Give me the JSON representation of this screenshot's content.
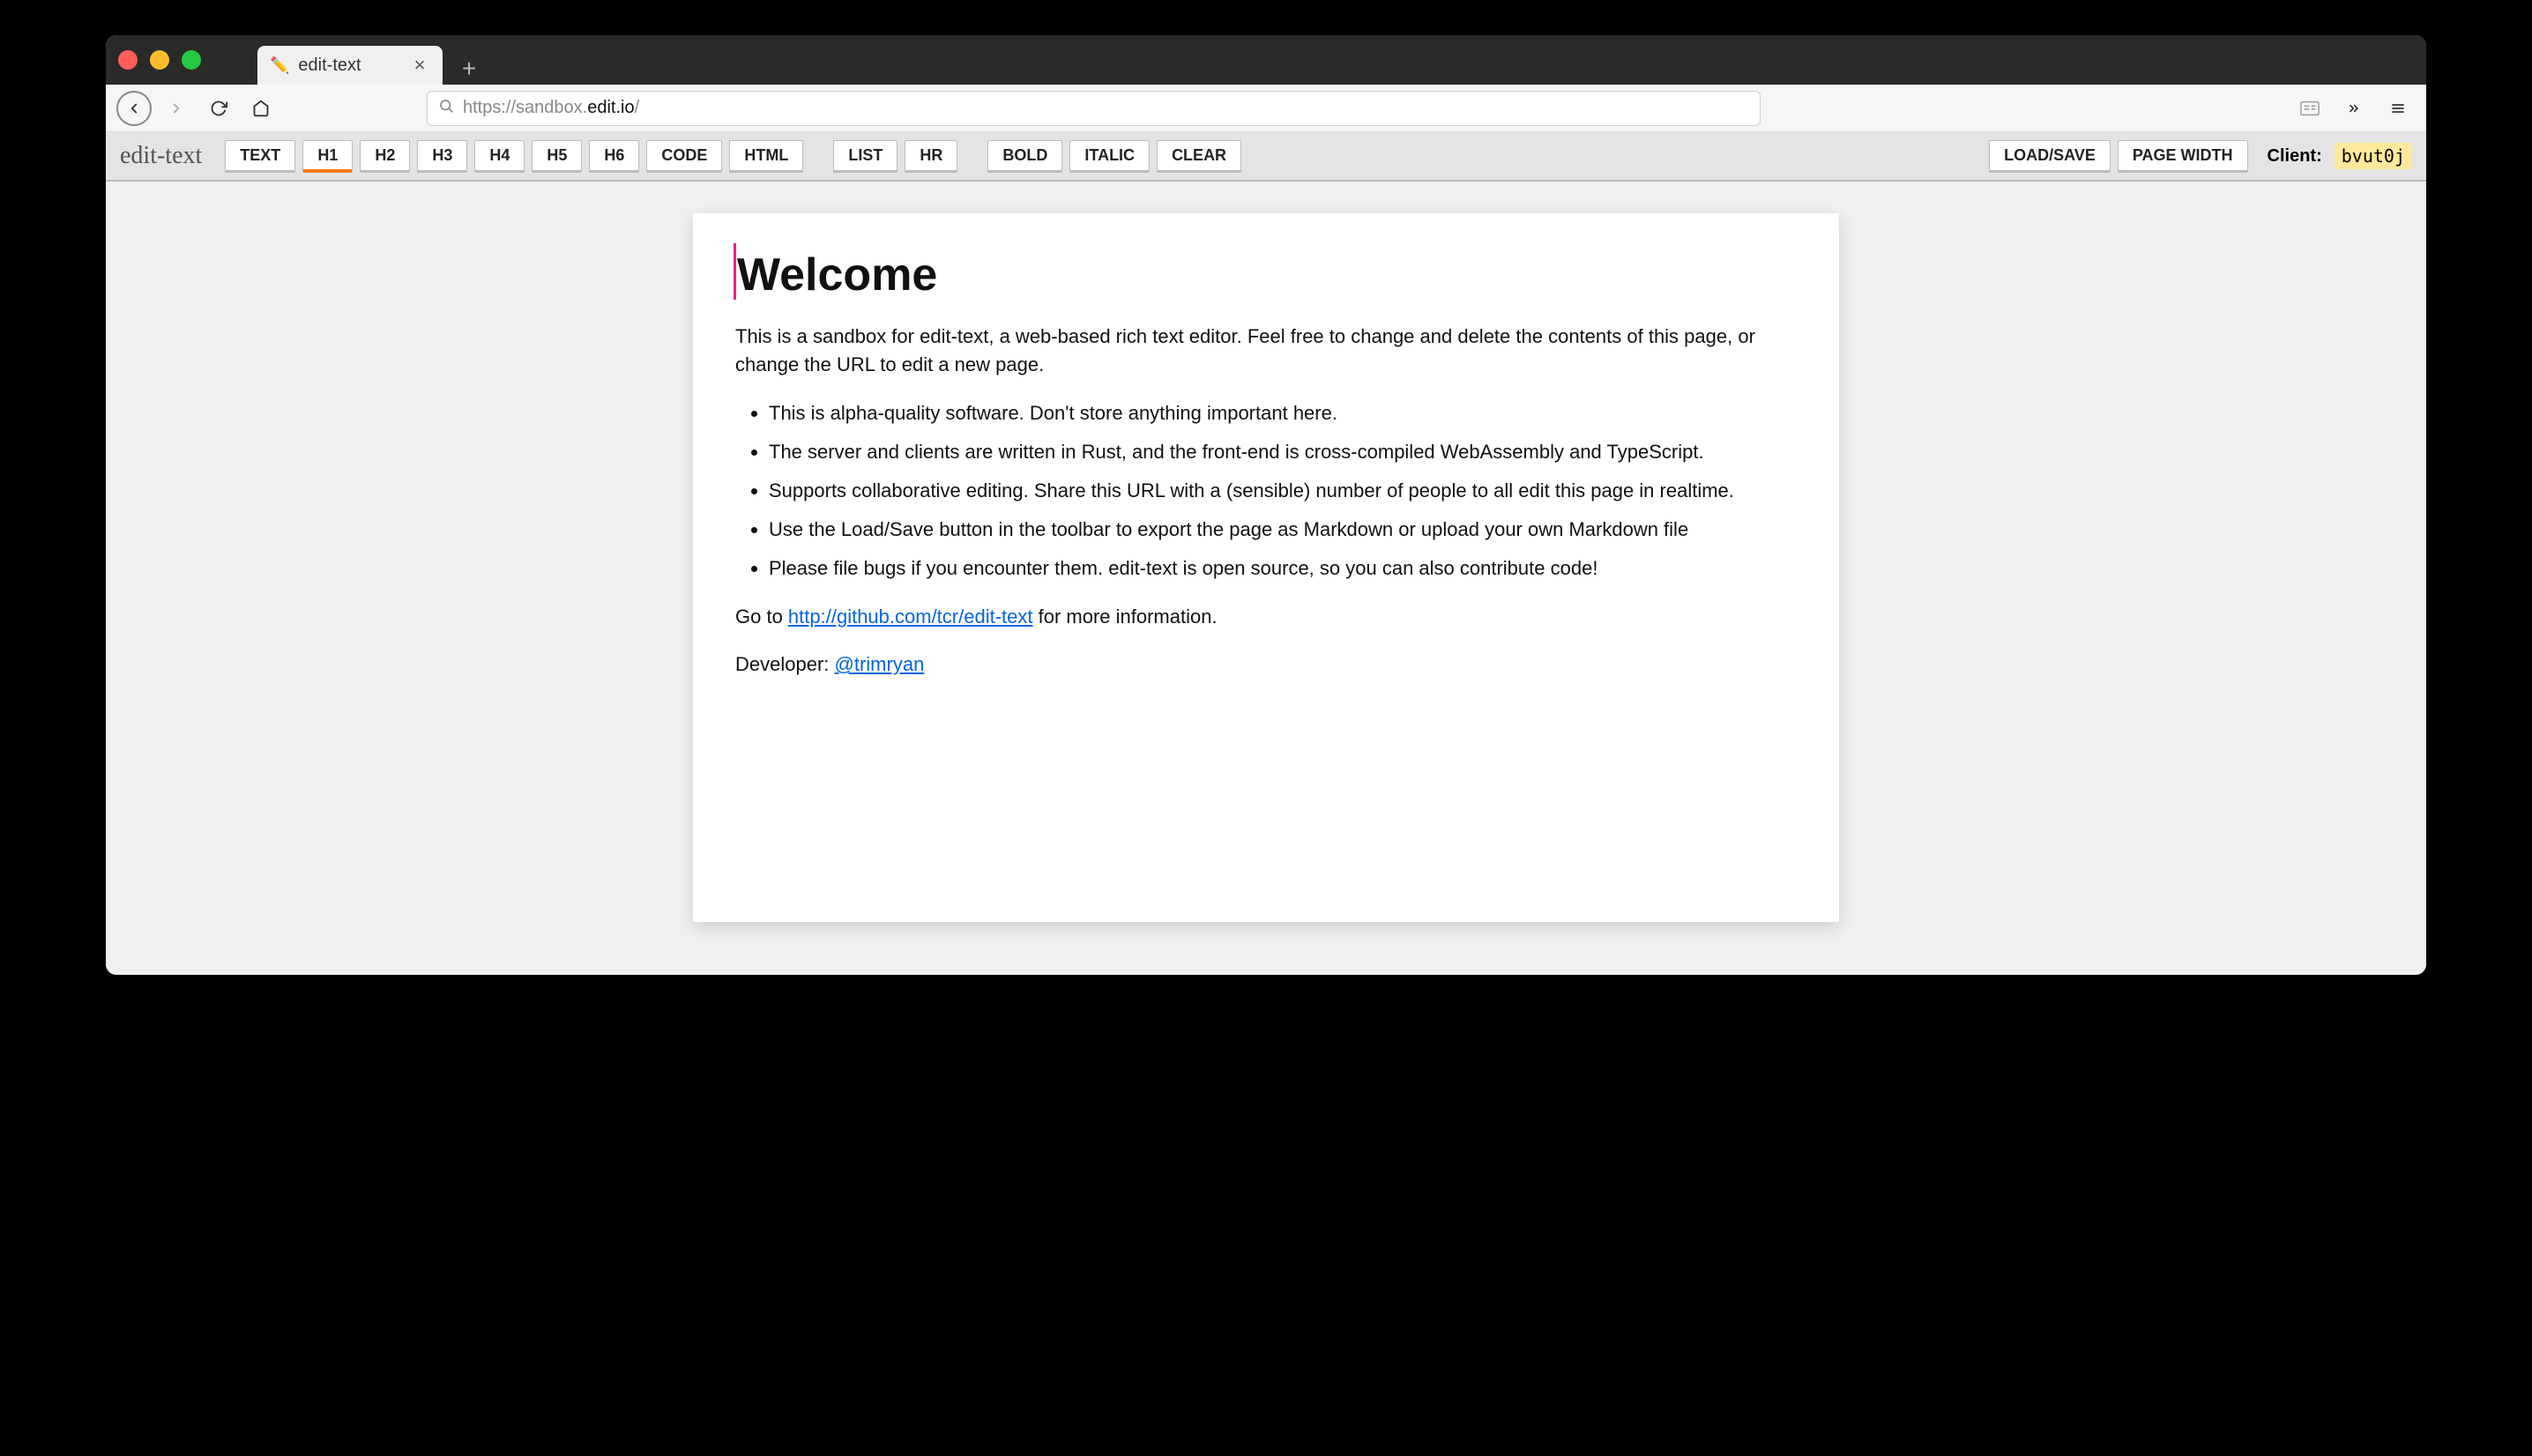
{
  "browser": {
    "tab_title": "edit-text",
    "tab_favicon": "✏️",
    "url_protocol": "https://sandbox.",
    "url_domain": "edit.io",
    "url_rest": "/"
  },
  "app": {
    "title": "edit-text",
    "toolbar": {
      "text": "TEXT",
      "h1": "H1",
      "h2": "H2",
      "h3": "H3",
      "h4": "H4",
      "h5": "H5",
      "h6": "H6",
      "code": "CODE",
      "html": "HTML",
      "list": "LIST",
      "hr": "HR",
      "bold": "BOLD",
      "italic": "ITALIC",
      "clear": "CLEAR",
      "loadsave": "LOAD/SAVE",
      "pagewidth": "PAGE WIDTH"
    },
    "client_label": "Client:",
    "client_id": "bvut0j"
  },
  "doc": {
    "heading": "Welcome",
    "intro": "This is a sandbox for edit-text, a web-based rich text editor. Feel free to change and delete the contents of this page, or change the URL to edit a new page.",
    "bullets": [
      "This is alpha-quality software. Don't store anything important here.",
      "The server and clients are written in Rust, and the front-end is cross-compiled WebAssembly and TypeScript.",
      "Supports collaborative editing. Share this URL with a (sensible) number of people to all edit this page in realtime.",
      "Use the Load/Save button in the toolbar to export the page as Markdown or upload your own Markdown file",
      "Please file bugs if you encounter them. edit-text is open source, so you can also contribute code!"
    ],
    "goto_pre": "Go to ",
    "goto_link": "http://github.com/tcr/edit-text",
    "goto_post": " for more information.",
    "dev_pre": "Developer: ",
    "dev_link": "@trimryan"
  }
}
